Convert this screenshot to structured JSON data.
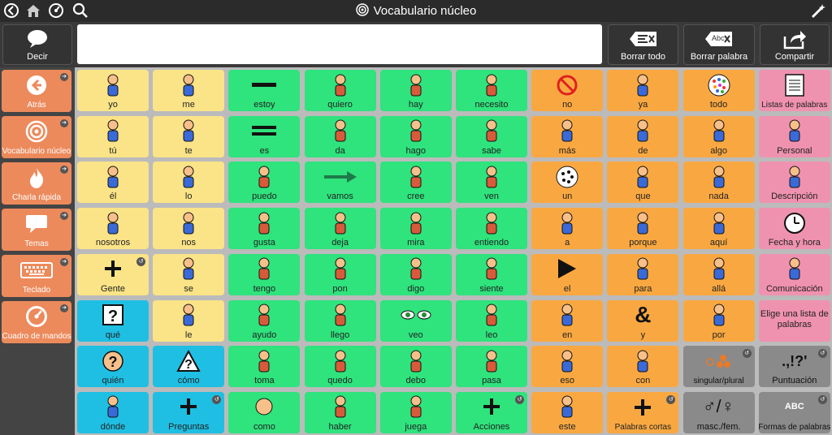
{
  "topbar": {
    "title": "Vocabulario núcleo"
  },
  "message_row": {
    "speak_label": "Decir",
    "clear_all_label": "Borrar todo",
    "clear_word_label": "Borrar palabra",
    "share_label": "Compartir",
    "clear_word_icon_text": "Abc"
  },
  "sidebar": {
    "items": [
      {
        "label": "Atrás",
        "icon": "back-arrow-icon"
      },
      {
        "label": "Vocabulario núcleo",
        "icon": "target-icon"
      },
      {
        "label": "Charla rápida",
        "icon": "flame-icon"
      },
      {
        "label": "Temas",
        "icon": "speech-bubble-icon"
      },
      {
        "label": "Teclado",
        "icon": "keyboard-icon"
      },
      {
        "label": "Cuadro de mandos",
        "icon": "dashboard-icon"
      }
    ]
  },
  "grid": {
    "rows": [
      [
        {
          "label": "yo",
          "color": "yellow",
          "icon": "person-self-icon"
        },
        {
          "label": "me",
          "color": "yellow",
          "icon": "person-self-icon"
        },
        {
          "label": "estoy",
          "color": "green",
          "icon": "minus-icon"
        },
        {
          "label": "quiero",
          "color": "green",
          "icon": "want-icon"
        },
        {
          "label": "hay",
          "color": "green",
          "icon": "there-is-icon"
        },
        {
          "label": "necesito",
          "color": "green",
          "icon": "need-icon"
        },
        {
          "label": "no",
          "color": "orange",
          "icon": "no-icon"
        },
        {
          "label": "ya",
          "color": "orange",
          "icon": "already-icon"
        },
        {
          "label": "todo",
          "color": "orange",
          "icon": "all-icon"
        },
        {
          "label": "Listas de palabras",
          "color": "pink",
          "icon": "notebook-icon"
        }
      ],
      [
        {
          "label": "tú",
          "color": "yellow",
          "icon": "you-icon"
        },
        {
          "label": "te",
          "color": "yellow",
          "icon": "fist-icon"
        },
        {
          "label": "es",
          "color": "green",
          "icon": "equals-icon"
        },
        {
          "label": "da",
          "color": "green",
          "icon": "give-icon"
        },
        {
          "label": "hago",
          "color": "green",
          "icon": "do-icon"
        },
        {
          "label": "sabe",
          "color": "green",
          "icon": "know-icon"
        },
        {
          "label": "más",
          "color": "orange",
          "icon": "more-icon"
        },
        {
          "label": "de",
          "color": "orange",
          "icon": "of-icon"
        },
        {
          "label": "algo",
          "color": "orange",
          "icon": "something-icon"
        },
        {
          "label": "Personal",
          "color": "pink",
          "icon": "person-icon"
        }
      ],
      [
        {
          "label": "él",
          "color": "yellow",
          "icon": "he-icon"
        },
        {
          "label": "lo",
          "color": "yellow",
          "icon": "it-icon"
        },
        {
          "label": "puedo",
          "color": "green",
          "icon": "can-icon"
        },
        {
          "label": "vamos",
          "color": "green",
          "icon": "arrow-right-icon"
        },
        {
          "label": "cree",
          "color": "green",
          "icon": "believe-icon"
        },
        {
          "label": "ven",
          "color": "green",
          "icon": "come-icon"
        },
        {
          "label": "un",
          "color": "orange",
          "icon": "one-icon"
        },
        {
          "label": "que",
          "color": "orange",
          "icon": "that-icon"
        },
        {
          "label": "nada",
          "color": "orange",
          "icon": "nothing-icon"
        },
        {
          "label": "Descripción",
          "color": "pink",
          "icon": "description-icon"
        }
      ],
      [
        {
          "label": "nosotros",
          "color": "yellow",
          "icon": "we-icon"
        },
        {
          "label": "nos",
          "color": "yellow",
          "icon": "us-icon"
        },
        {
          "label": "gusta",
          "color": "green",
          "icon": "like-icon"
        },
        {
          "label": "deja",
          "color": "green",
          "icon": "let-icon"
        },
        {
          "label": "mira",
          "color": "green",
          "icon": "look-icon"
        },
        {
          "label": "entiendo",
          "color": "green",
          "icon": "understand-icon"
        },
        {
          "label": "a",
          "color": "orange",
          "icon": "to-icon"
        },
        {
          "label": "porque",
          "color": "orange",
          "icon": "because-icon"
        },
        {
          "label": "aquí",
          "color": "orange",
          "icon": "here-icon"
        },
        {
          "label": "Fecha y hora",
          "color": "pink",
          "icon": "clock-icon"
        }
      ],
      [
        {
          "label": "Gente",
          "color": "yellow",
          "icon": "plus-icon",
          "more": true
        },
        {
          "label": "se",
          "color": "yellow",
          "icon": "self-icon"
        },
        {
          "label": "tengo",
          "color": "green",
          "icon": "have-icon"
        },
        {
          "label": "pon",
          "color": "green",
          "icon": "put-icon"
        },
        {
          "label": "digo",
          "color": "green",
          "icon": "say-icon"
        },
        {
          "label": "siente",
          "color": "green",
          "icon": "feel-icon"
        },
        {
          "label": "el",
          "color": "orange",
          "icon": "play-triangle-icon"
        },
        {
          "label": "para",
          "color": "orange",
          "icon": "for-icon"
        },
        {
          "label": "allá",
          "color": "orange",
          "icon": "there-icon"
        },
        {
          "label": "Comunicación",
          "color": "pink",
          "icon": "communication-icon"
        }
      ],
      [
        {
          "label": "qué",
          "color": "blue",
          "icon": "question-box-icon"
        },
        {
          "label": "le",
          "color": "yellow",
          "icon": "him-icon"
        },
        {
          "label": "ayudo",
          "color": "green",
          "icon": "help-icon"
        },
        {
          "label": "llego",
          "color": "green",
          "icon": "arrive-icon"
        },
        {
          "label": "veo",
          "color": "green",
          "icon": "eyes-icon"
        },
        {
          "label": "leo",
          "color": "green",
          "icon": "read-icon"
        },
        {
          "label": "en",
          "color": "orange",
          "icon": "in-icon"
        },
        {
          "label": "y",
          "color": "orange",
          "icon": "ampersand-icon"
        },
        {
          "label": "por",
          "color": "orange",
          "icon": "by-icon"
        },
        {
          "label": "Elige una lista de palabras",
          "color": "pink",
          "icon": "",
          "multiline": true
        }
      ],
      [
        {
          "label": "quién",
          "color": "blue",
          "icon": "who-icon"
        },
        {
          "label": "cómo",
          "color": "blue",
          "icon": "how-icon"
        },
        {
          "label": "toma",
          "color": "green",
          "icon": "take-icon"
        },
        {
          "label": "quedo",
          "color": "green",
          "icon": "stay-icon"
        },
        {
          "label": "debo",
          "color": "green",
          "icon": "must-icon"
        },
        {
          "label": "pasa",
          "color": "green",
          "icon": "happen-icon"
        },
        {
          "label": "eso",
          "color": "orange",
          "icon": "that-one-icon"
        },
        {
          "label": "con",
          "color": "orange",
          "icon": "with-icon"
        },
        {
          "label": "singular/plural",
          "color": "grey",
          "icon": "singular-plural-icon",
          "more": true
        },
        {
          "label": "Puntuación",
          "color": "grey",
          "icon": "punctuation-icon",
          "more": true,
          "icon_text": ".,!?'"
        }
      ],
      [
        {
          "label": "dónde",
          "color": "blue",
          "icon": "where-icon"
        },
        {
          "label": "Preguntas",
          "color": "blue",
          "icon": "plus-icon",
          "more": true
        },
        {
          "label": "como",
          "color": "green",
          "icon": "eat-icon"
        },
        {
          "label": "haber",
          "color": "green",
          "icon": "haber-icon"
        },
        {
          "label": "juega",
          "color": "green",
          "icon": "play-icon"
        },
        {
          "label": "Acciones",
          "color": "green",
          "icon": "plus-icon",
          "more": true
        },
        {
          "label": "este",
          "color": "orange",
          "icon": "this-icon"
        },
        {
          "label": "Palabras cortas",
          "color": "orange",
          "icon": "plus-icon",
          "more": true
        },
        {
          "label": "masc./fem.",
          "color": "grey",
          "icon": "gender-icon"
        },
        {
          "label": "Formas de palabras",
          "color": "grey",
          "icon": "word-forms-icon",
          "more": true,
          "icon_text": "ABC"
        }
      ]
    ]
  }
}
